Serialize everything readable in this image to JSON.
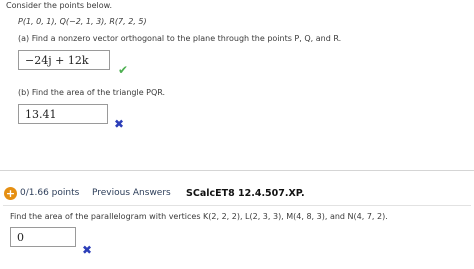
{
  "problem1": {
    "intro": "Consider the points below.",
    "points": "P(1, 0, 1),  Q(−2, 1, 3),  R(7, 2, 5)",
    "part_a": {
      "prompt": "(a) Find a nonzero vector orthogonal to the plane through the points  P,  Q,  and  R.",
      "answer": "−24j + 12k",
      "status": "correct"
    },
    "part_b": {
      "prompt": "(b) Find the area of the triangle PQR.",
      "answer": "13.41",
      "status": "incorrect"
    }
  },
  "problem2": {
    "score": "0/1.66 points",
    "previous_answers": "Previous Answers",
    "code": "SCalcET8 12.4.507.XP.",
    "prompt": "Find the area of the parallelogram with vertices  K(2, 2, 2),  L(2, 3, 3),  M(4, 8, 3),  and  N(4, 7, 2).",
    "answer": "0",
    "status": "incorrect"
  },
  "icons": {
    "correct": "check-icon",
    "incorrect": "cross-icon",
    "score": "plus-circle-icon"
  },
  "colors": {
    "correct": "#4caf50",
    "incorrect": "#2c3eb8",
    "score_badge": "#e58f12",
    "link": "#2d3e5a"
  }
}
